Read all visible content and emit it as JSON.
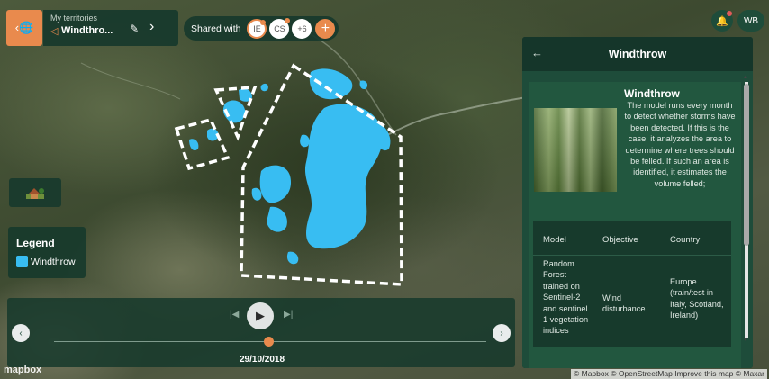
{
  "territory": {
    "caption": "My territories",
    "name": "Windthro...",
    "back_icon": "globe-back-icon",
    "next_icon": "chevron-right-icon"
  },
  "shared": {
    "label": "Shared with",
    "users": [
      "IE",
      "CS",
      "+6"
    ],
    "add_label": "+"
  },
  "user": {
    "initials": "WB"
  },
  "legend": {
    "title": "Legend",
    "items": [
      {
        "label": "Windthrow",
        "color": "#38bdf2"
      }
    ]
  },
  "timeline": {
    "date": "29/10/2018",
    "progress": 0.5
  },
  "panel": {
    "title": "Windthrow",
    "card_title": "Windthrow",
    "description": "The model runs every month to detect whether storms have been detected. If this is the case, it analyzes the area to determine where trees should be felled. If such an area is identified, it estimates the volume felled;",
    "table": {
      "headers": [
        "Model",
        "Objective",
        "Country"
      ],
      "row": {
        "model": "Random Forest trained on Sentinel-2 and sentinel 1 vegetation indices",
        "objective": "Wind disturbance",
        "country": "Europe (train/test in Italy, Scotland, Ireland)"
      }
    }
  },
  "map": {
    "attribution": "© Mapbox © OpenStreetMap  Improve this map © Maxar",
    "logo": "mapbox",
    "windthrow_color": "#38bdf2"
  }
}
